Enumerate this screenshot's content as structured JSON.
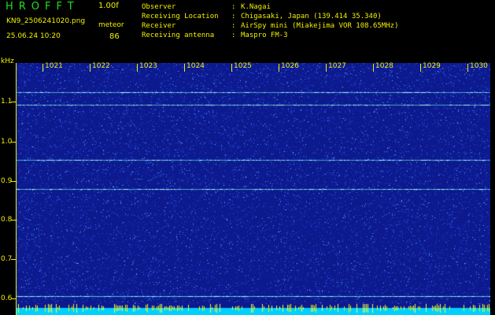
{
  "header": {
    "app_title": "HROFFT",
    "version": "1.00f",
    "filename": "KN9_2506241020.png",
    "meteor_label": "meteor",
    "datetime": "25.06.24 10:20",
    "meteor_count": "86"
  },
  "info": [
    {
      "label": "Observer",
      "value": "K.Nagai"
    },
    {
      "label": "Receiving Location",
      "value": "Chigasaki, Japan (139.414 35.340)"
    },
    {
      "label": "Receiver",
      "value": "AirSpy mini (Miakejima VOR 108.65MHz)"
    },
    {
      "label": "Receiving antenna",
      "value": "Maspro FM-3"
    }
  ],
  "axis": {
    "y_unit": "kHz",
    "x_ticks": [
      "1021",
      "1022",
      "1023",
      "1024",
      "1025",
      "1026",
      "1027",
      "1028",
      "1029",
      "1030"
    ],
    "y_ticks": [
      "1.1",
      "1.0",
      "0.9",
      "0.8",
      "0.7",
      "0.6"
    ]
  },
  "colors": {
    "background": "#000000",
    "label_yellow": "#f0f000",
    "title_green": "#1fe01f",
    "noise_floor": "#0c1a8e",
    "echo_line": "#5fe0e0",
    "bottom_bar": "#00d0ff"
  },
  "spectrogram": {
    "y_range_khz": [
      0.58,
      1.18
    ],
    "carrier_lines_khz": [
      1.11,
      1.08,
      0.95,
      0.88,
      0.625
    ]
  }
}
